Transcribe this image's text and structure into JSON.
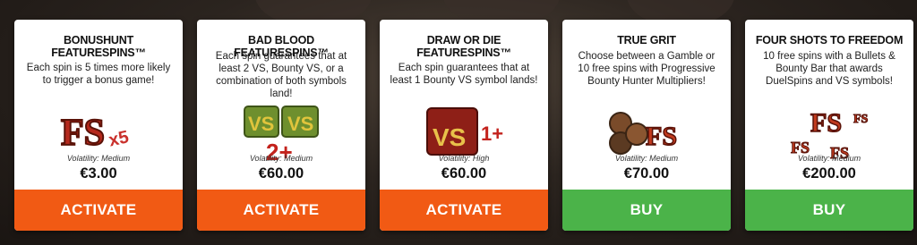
{
  "colors": {
    "activate_button": "#f15a14",
    "buy_button": "#4bb349",
    "card_background": "#ffffff"
  },
  "cards": [
    {
      "title": "BONUSHUNT FEATURESPINS™",
      "description": "Each spin is 5 times more likely to trigger a bonus game!",
      "icon": "fs-x5-icon",
      "volatility": "Volatility: Medium",
      "price": "€3.00",
      "button": "ACTIVATE"
    },
    {
      "title": "BAD BLOOD FEATURESPINS™",
      "description": "Each spin guarantees that at least 2 VS, Bounty VS, or a combination of both symbols land!",
      "icon": "vs-bounty-2plus-icon",
      "volatility": "Volatility: Medium",
      "price": "€60.00",
      "button": "ACTIVATE"
    },
    {
      "title": "DRAW OR DIE FEATURESPINS™",
      "description": "Each spin guarantees that at least 1 Bounty VS symbol lands!",
      "icon": "bounty-vs-1plus-icon",
      "volatility": "Volatility: High",
      "price": "€60.00",
      "button": "ACTIVATE"
    },
    {
      "title": "TRUE GRIT",
      "description": "Choose between a Gamble or 10 free spins with Progressive Bounty Hunter Multipliers!",
      "icon": "fs-chips-icon",
      "volatility": "Volatility: Medium",
      "price": "€70.00",
      "button": "BUY"
    },
    {
      "title": "FOUR SHOTS TO FREEDOM",
      "description": "10 free spins with a Bullets & Bounty Bar that awards DuelSpins and VS symbols!",
      "icon": "fs-scatter-icon",
      "volatility": "Volatility: Medium",
      "price": "€200.00",
      "button": "BUY"
    }
  ]
}
